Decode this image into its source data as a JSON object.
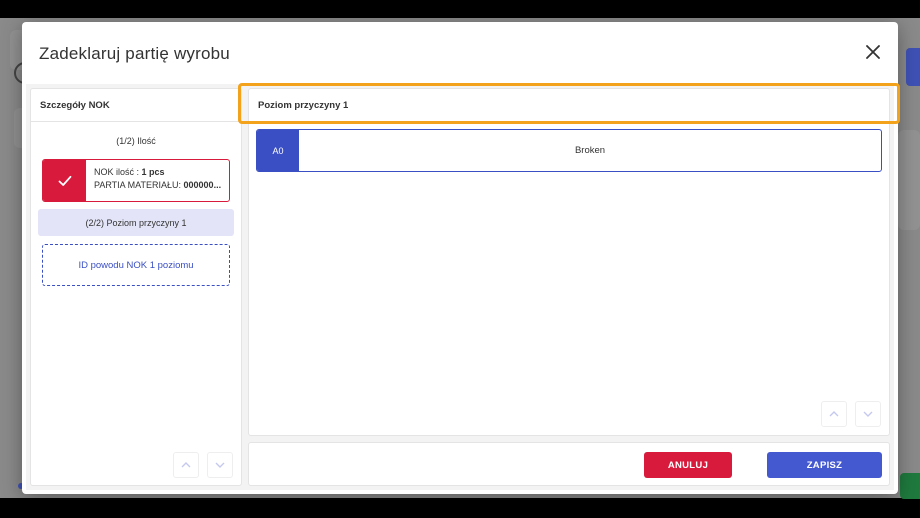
{
  "dialog": {
    "title": "Zadeklaruj partię wyrobu",
    "close_icon": "close-icon"
  },
  "left_panel": {
    "header": "Szczegóły NOK",
    "step1_label": "(1/2) Ilość",
    "nok_card": {
      "qty_label": "NOK ilość : ",
      "qty_value": "1 pcs",
      "batch_label": "PARTIA MATERIAŁU: ",
      "batch_value": "000000...",
      "check_icon": "check-icon",
      "accent": "#d81b3c"
    },
    "step2_label": "(2/2) Poziom przyczyny 1",
    "id_placeholder": "ID powodu NOK 1 poziomu"
  },
  "right_panel": {
    "header": "Poziom przyczyny 1",
    "reasons": [
      {
        "code": "A0",
        "name": "Broken"
      }
    ],
    "highlight_color": "#f3a31b"
  },
  "footer": {
    "cancel_label": "ANULUJ",
    "save_label": "ZAPISZ",
    "cancel_color": "#d81b3c",
    "save_color": "#4459d0"
  }
}
